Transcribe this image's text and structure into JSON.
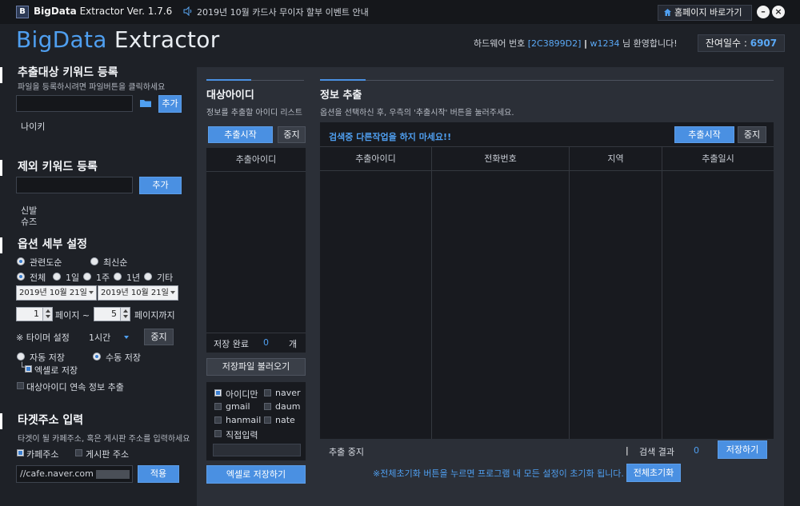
{
  "titlebar": {
    "logo_letter": "B",
    "app_name_bold": "BigData",
    "app_name_rest": " Extractor",
    "version": "Ver. 1.7.6",
    "notice": "2019년 10월 카드사 무이자 할부 이벤트 안내",
    "home_button": "홈페이지 바로가기",
    "minimize": "–",
    "close": "×"
  },
  "header": {
    "brand_big": "BigData",
    "brand_rest": " Extractor",
    "hw_label": "하드웨어 번호",
    "hw_value": "[2C3899D2]",
    "separator": "|",
    "user": "w1234",
    "welcome": "님 환영합니다!",
    "days_label": "잔여일수 : ",
    "days_value": "6907"
  },
  "left": {
    "keyword_title": "추출대상 키워드 등록",
    "keyword_sub": "파일을 등록하시려면 파일버튼을 클릭하세요",
    "keyword_input": "",
    "add_label": "추가",
    "keywords": [
      "나이키"
    ],
    "exclude_title": "제외 키워드 등록",
    "exclude_input": "",
    "exclude_add": "추가",
    "exclude_keywords": [
      "신발",
      "슈즈"
    ],
    "option_title": "옵션 세부 설정",
    "sort_relevance": "관련도순",
    "sort_latest": "최신순",
    "period_all": "전체",
    "period_1d": "1일",
    "period_1w": "1주",
    "period_1y": "1년",
    "period_etc": "기타",
    "date_from": "2019년 10월 21일",
    "date_to": "2019년 10월 21일",
    "page_from": "1",
    "page_label": "페이지 ~",
    "page_to": "5",
    "page_to_label": "페이지까지",
    "timer_label": "※ 타이머 설정",
    "timer_value": "1시간",
    "timer_stop": "중지",
    "auto_save": "자동 저장",
    "manual_save": "수동 저장",
    "excel_save": "엑셀로 저장",
    "continuous": "대상아이디 연속 정보 추출",
    "target_title": "타겟주소 입력",
    "target_sub": "타겟이 될 카페주소, 혹은 게시판 주소를 입력하세요",
    "cafe_addr": "카페주소",
    "board_addr": "게시판 주소",
    "url_value": "//cafe.naver.com",
    "apply": "적용"
  },
  "middle": {
    "title": "대상아이디",
    "sub": "정보를 추출할 아이디 리스트",
    "start": "추출시작",
    "stop": "중지",
    "col": "추출아이디",
    "saved_label": "저장 완료",
    "saved_count": "0",
    "saved_unit": "개",
    "load_button": "저장파일 불러오기",
    "opt_id_only": "아이디만",
    "opt_naver": "naver",
    "opt_gmail": "gmail",
    "opt_daum": "daum",
    "opt_hanmail": "hanmail",
    "opt_nate": "nate",
    "opt_direct": "직접입력",
    "excel_button": "엑셀로 저장하기"
  },
  "right": {
    "title": "정보 추출",
    "sub": "옵션을 선택하신 후, 우측의 '추출시작' 버튼을 눌러주세요.",
    "warning": "검색중 다른작업을 하지 마세요!!",
    "start": "추출시작",
    "stop": "중지",
    "columns": [
      "추출아이디",
      "전화번호",
      "지역",
      "추출일시"
    ],
    "status": "추출 중지",
    "result_sep": "|",
    "result_label": "검색 결과",
    "result_count": "0",
    "save": "저장하기",
    "reset_note": "※전체초기화 버튼을 누르면 프로그램 내 모든 설정이 초기화 됩니다.",
    "reset_button": "전체초기화"
  },
  "colors": {
    "accent": "#4a90e2",
    "brand": "#4f9ff0",
    "bg": "#1e2127",
    "panel": "#2b2f37"
  }
}
